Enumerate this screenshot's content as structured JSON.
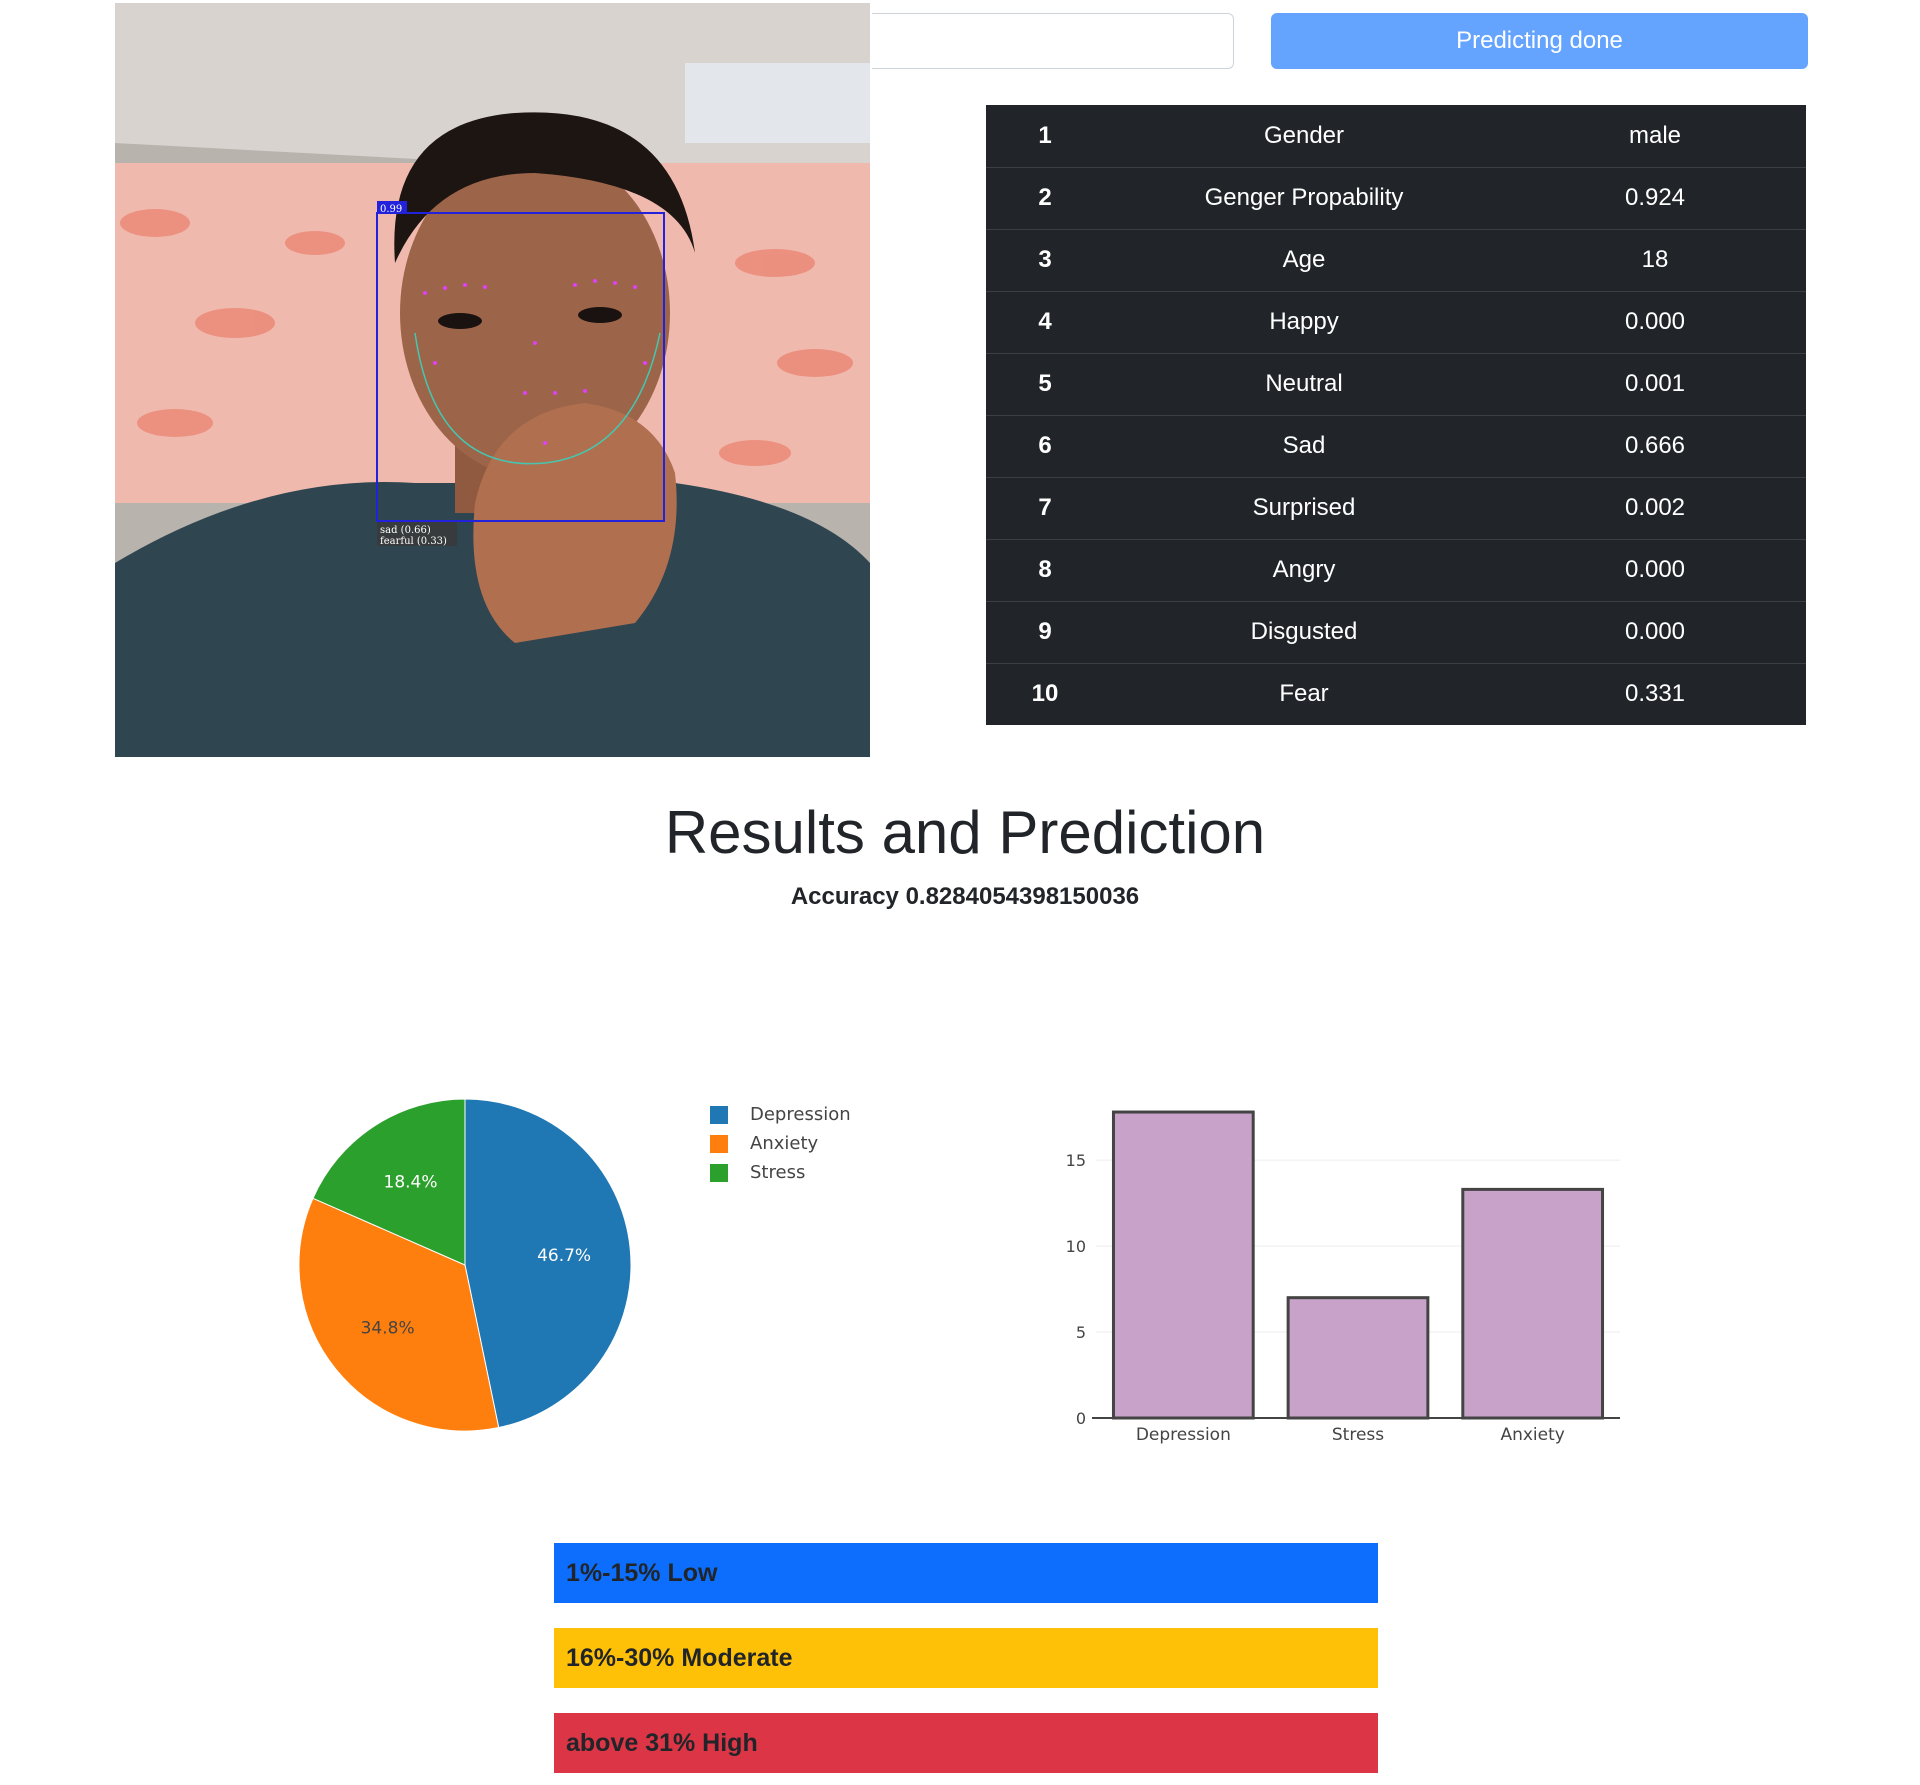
{
  "photo": {
    "face_box_score": "0.99",
    "expression_labels": [
      "sad (0.66)",
      "fearful (0.33)"
    ]
  },
  "controls": {
    "input_value": "",
    "predict_button_label": "Predicting done",
    "predict_button_color": "#64a3fe"
  },
  "results_table": {
    "rows": [
      {
        "index": "1",
        "label": "Gender",
        "value": "male"
      },
      {
        "index": "2",
        "label": "Genger Propability",
        "value": "0.924"
      },
      {
        "index": "3",
        "label": "Age",
        "value": "18"
      },
      {
        "index": "4",
        "label": "Happy",
        "value": "0.000"
      },
      {
        "index": "5",
        "label": "Neutral",
        "value": "0.001"
      },
      {
        "index": "6",
        "label": "Sad",
        "value": "0.666"
      },
      {
        "index": "7",
        "label": "Surprised",
        "value": "0.002"
      },
      {
        "index": "8",
        "label": "Angry",
        "value": "0.000"
      },
      {
        "index": "9",
        "label": "Disgusted",
        "value": "0.000"
      },
      {
        "index": "10",
        "label": "Fear",
        "value": "0.331"
      }
    ]
  },
  "header": {
    "title": "Results and Prediction",
    "accuracy_text": "Accuracy 0.8284054398150036"
  },
  "chart_data": [
    {
      "type": "pie",
      "labels": [
        "Depression",
        "Anxiety",
        "Stress"
      ],
      "values": [
        46.7,
        34.8,
        18.4
      ],
      "text_labels": [
        "46.7%",
        "34.8%",
        "18.4%"
      ],
      "colors": [
        "#1f77b4",
        "#ff7f0e",
        "#2ca02c"
      ],
      "legend": "right"
    },
    {
      "type": "bar",
      "categories": [
        "Depression",
        "Stress",
        "Anxiety"
      ],
      "values": [
        17.8,
        7.0,
        13.3
      ],
      "bar_color": "#c8a2c8",
      "bar_outline": "#444444",
      "ylim": [
        0,
        18.5
      ],
      "yticks": [
        "0",
        "5",
        "10",
        "15"
      ],
      "grid": true
    }
  ],
  "levels": [
    {
      "label": "1%-15% Low",
      "color": "#0d6efd"
    },
    {
      "label": "16%-30% Moderate",
      "color": "#ffc107"
    },
    {
      "label": "above 31% High",
      "color": "#dc3545"
    }
  ]
}
